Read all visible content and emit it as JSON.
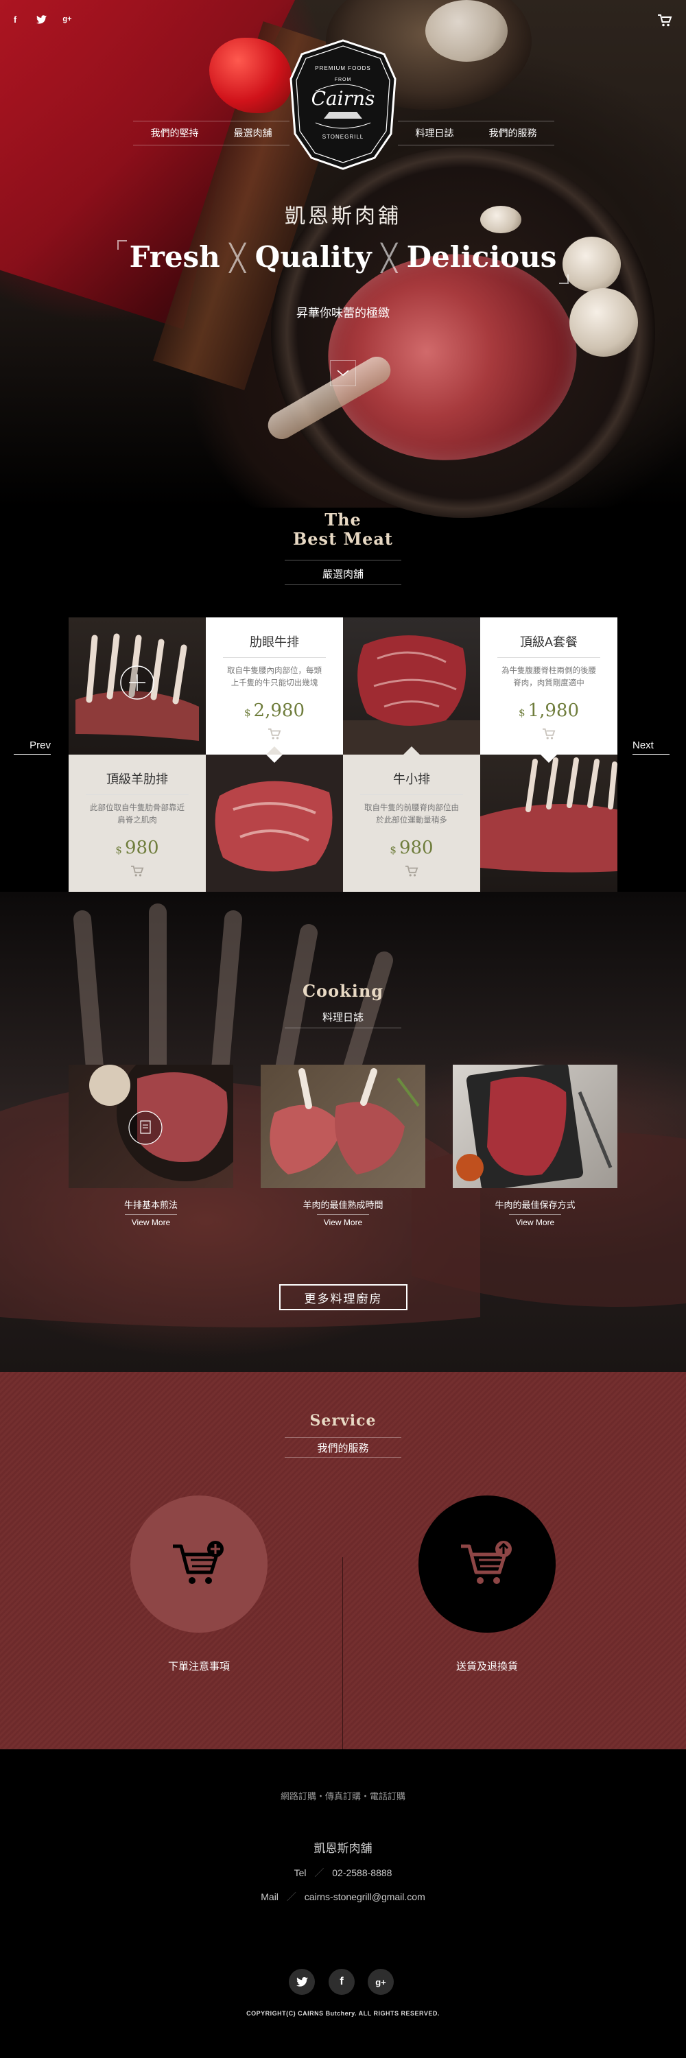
{
  "header": {
    "social": [
      "f",
      "twitter",
      "g+"
    ],
    "nav_left": [
      "我們的堅持",
      "最選肉舖"
    ],
    "nav_right": [
      "料理日誌",
      "我們的服務"
    ],
    "logo": {
      "top": "PREMIUM FOODS",
      "from": "FROM",
      "name": "Cairns",
      "bottom": "STONEGRILL"
    }
  },
  "hero": {
    "brand": "凱恩斯肉舖",
    "words": [
      "Fresh",
      "Quality",
      "Delicious"
    ],
    "subtitle": "昇華你味蕾的極緻"
  },
  "best_meat": {
    "title_line1": "The",
    "title_line2": "Best Meat",
    "subtitle": "嚴選肉舖",
    "prev": "Prev",
    "next": "Next",
    "products": [
      {
        "name": "肋眼牛排",
        "desc": "取自牛隻腰內肉部位，每頭上千隻的牛只能切出幾塊",
        "currency": "$",
        "price": "2,980"
      },
      {
        "name": "頂級A套餐",
        "desc": "為牛隻腹腰脊柱兩側的後腰脊肉，肉質剛度適中",
        "currency": "$",
        "price": "1,980"
      },
      {
        "name": "頂級羊肋排",
        "desc": "此部位取自牛隻肋骨部靠近肩脊之肌肉",
        "currency": "$",
        "price": "980"
      },
      {
        "name": "牛小排",
        "desc": "取自牛隻的前腰脊肉部位由於此部位運動量稍多",
        "currency": "$",
        "price": "980"
      }
    ]
  },
  "cooking": {
    "title": "Cooking",
    "subtitle": "料理日誌",
    "items": [
      {
        "title": "牛排基本煎法",
        "more": "View More"
      },
      {
        "title": "羊肉的最佳熟成時間",
        "more": "View More"
      },
      {
        "title": "牛肉的最佳保存方式",
        "more": "View More"
      }
    ],
    "more_button": "更多料理廚房"
  },
  "service": {
    "title": "Service",
    "subtitle": "我們的服務",
    "items": [
      {
        "label": "下單注意事項",
        "color": "#8e4646"
      },
      {
        "label": "送貨及退換貨",
        "color": "#000000"
      }
    ]
  },
  "footer": {
    "ordering": "網路訂購・傳真訂購・電話訂購",
    "name": "凱恩斯肉舖",
    "tel_label": "Tel",
    "tel": "02-2588-8888",
    "mail_label": "Mail",
    "mail": "cairns-stonegrill@gmail.com",
    "social": [
      "twitter",
      "f",
      "g+"
    ],
    "copyright": "COPYRIGHT(C) CAIRNS Butchery. ALL RIGHTS RESERVED."
  },
  "colors": {
    "accent_olive": "#6f7d3c",
    "service_bg": "#742f2f",
    "title_beige": "#e8d9c4"
  }
}
